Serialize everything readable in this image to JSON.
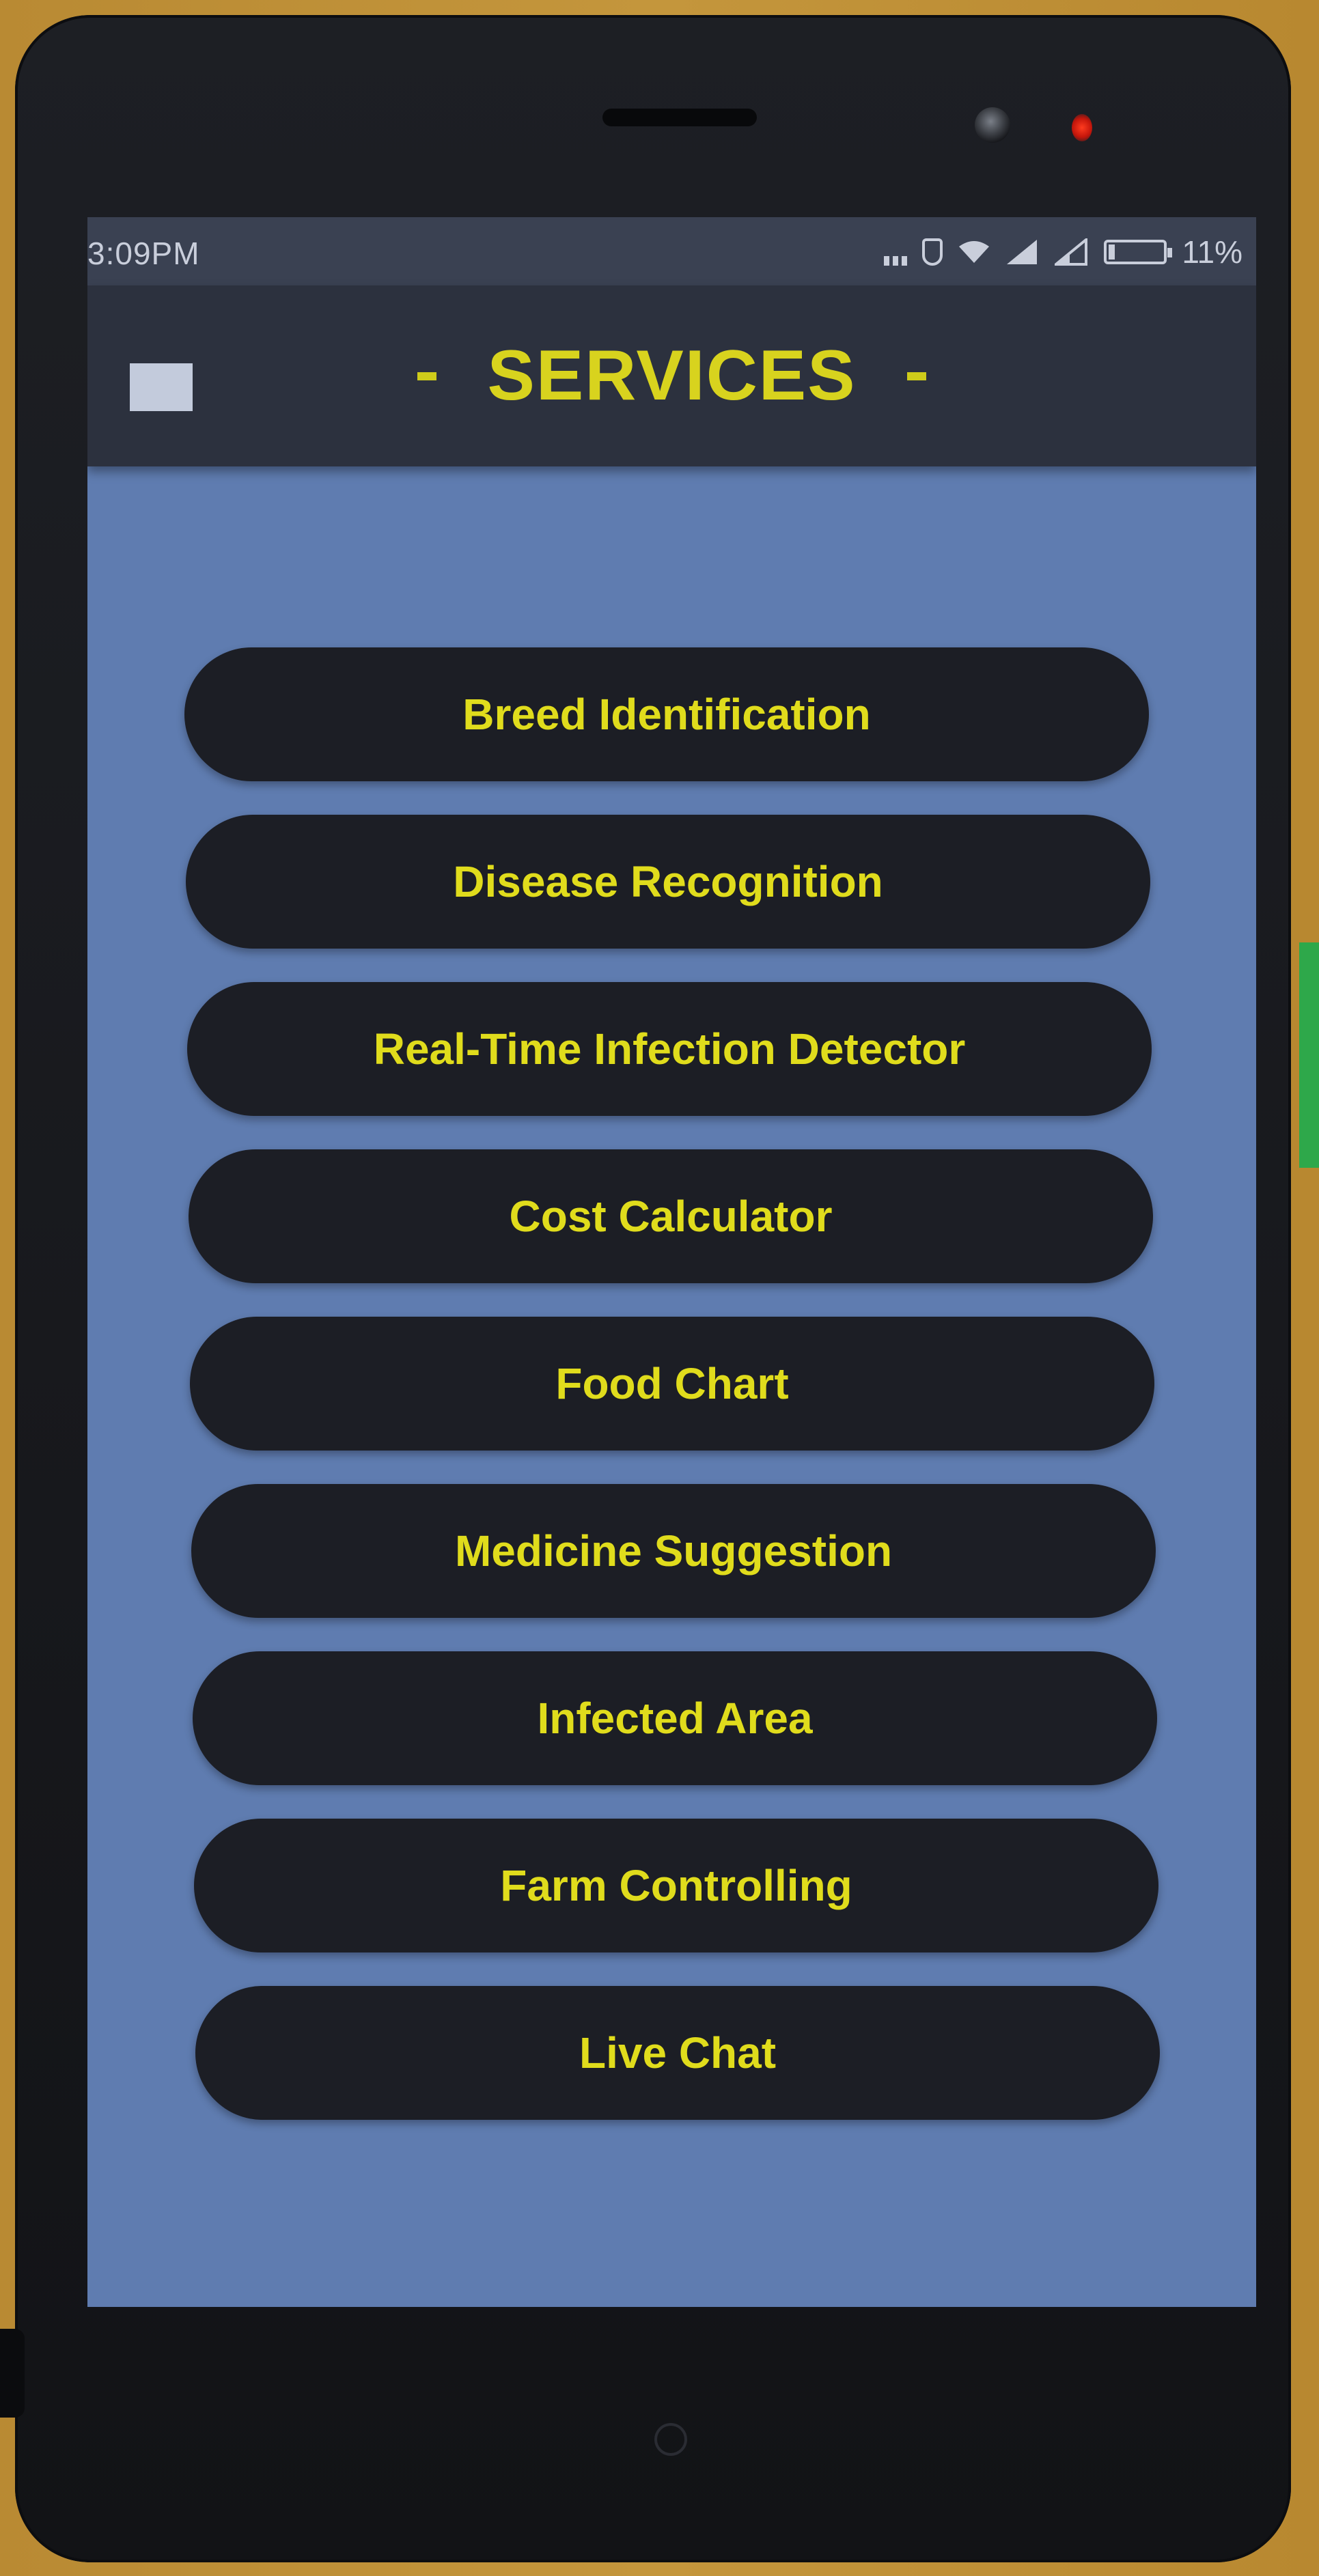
{
  "status_bar": {
    "time": "3:09PM",
    "battery_text": "11%",
    "battery_level": 0.11
  },
  "header": {
    "title": "SERVICES"
  },
  "services": [
    {
      "label": "Breed Identification"
    },
    {
      "label": "Disease Recognition"
    },
    {
      "label": "Real-Time Infection Detector"
    },
    {
      "label": "Cost Calculator"
    },
    {
      "label": "Food Chart"
    },
    {
      "label": "Medicine Suggestion"
    },
    {
      "label": "Infected Area"
    },
    {
      "label": "Farm Controlling"
    },
    {
      "label": "Live Chat"
    }
  ],
  "colors": {
    "accent_text": "#e0dc1c",
    "button_bg": "#1c1e25",
    "screen_bg": "#5f7cb0",
    "app_bar_bg": "#2c313e"
  },
  "icons": {
    "menu": "hamburger-menu-icon",
    "wifi": "wifi-icon",
    "signal": "signal-icon",
    "battery": "battery-icon"
  }
}
